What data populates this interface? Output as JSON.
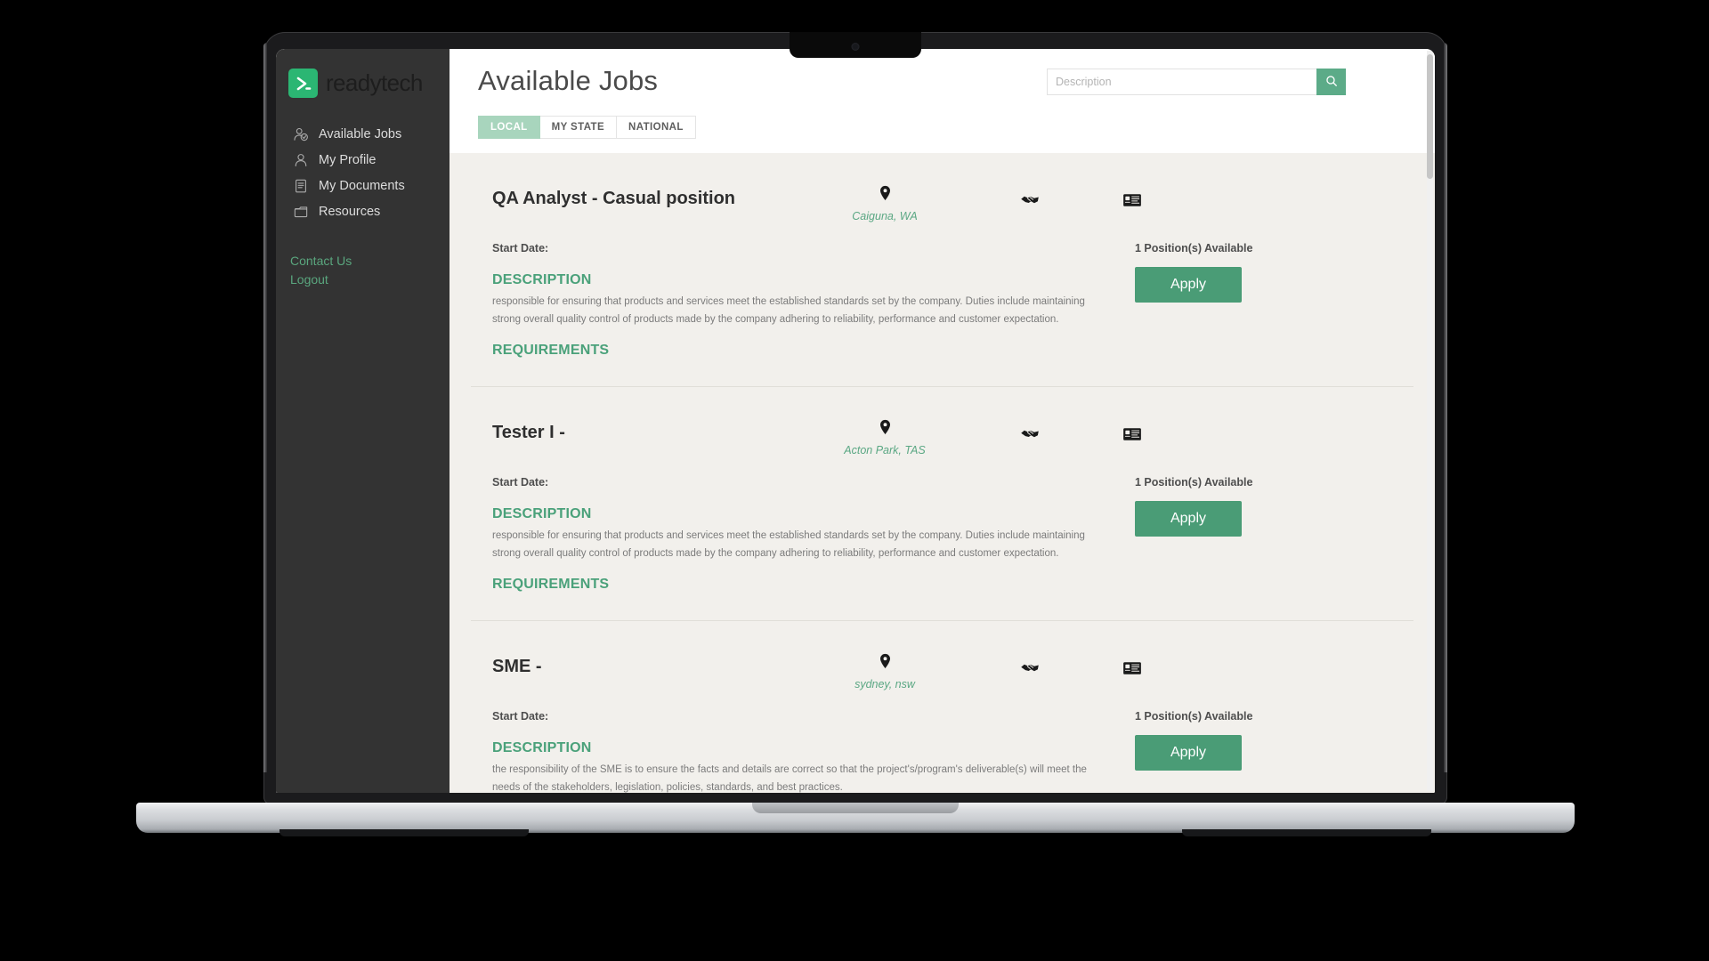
{
  "brand": {
    "name": "readytech",
    "mark_icon": "chevron-right-mark"
  },
  "sidebar": {
    "items": [
      {
        "label": "Available Jobs",
        "icon": "user-check-icon"
      },
      {
        "label": "My Profile",
        "icon": "user-icon"
      },
      {
        "label": "My Documents",
        "icon": "document-icon"
      },
      {
        "label": "Resources",
        "icon": "folder-icon"
      }
    ],
    "links": [
      {
        "label": "Contact Us"
      },
      {
        "label": "Logout"
      }
    ]
  },
  "header": {
    "title": "Available Jobs",
    "search": {
      "placeholder": "Description",
      "value": "",
      "button_icon": "search-icon"
    },
    "tabs": [
      {
        "label": "LOCAL",
        "active": true
      },
      {
        "label": "MY STATE",
        "active": false
      },
      {
        "label": "NATIONAL",
        "active": false
      }
    ]
  },
  "labels": {
    "start_date": "Start Date:",
    "description_heading": "DESCRIPTION",
    "requirements_heading": "REQUIREMENTS",
    "apply_button": "Apply",
    "location_icon": "map-pin-icon",
    "handshake_icon": "handshake-icon",
    "idcard_icon": "id-card-icon"
  },
  "jobs": [
    {
      "title": "QA Analyst - Casual position",
      "location": "Caiguna, WA",
      "start_date": "Start Date:",
      "description": "responsible for ensuring that products and services meet the established standards set by the company. Duties include maintaining strong overall quality control of products made by the company adhering to reliability, performance and customer expectation.",
      "requirements": "",
      "positions": "1 Position(s) Available",
      "apply": "Apply"
    },
    {
      "title": "Tester I -",
      "location": "Acton Park, TAS",
      "start_date": "Start Date:",
      "description": "responsible for ensuring that products and services meet the established standards set by the company. Duties include maintaining strong overall quality control of products made by the company adhering to reliability, performance and customer expectation.",
      "requirements": "",
      "positions": "1 Position(s) Available",
      "apply": "Apply"
    },
    {
      "title": "SME -",
      "location": "sydney, nsw",
      "start_date": "Start Date:",
      "description": "the responsibility of the SME is to ensure the facts and details are correct so that the project's/program's deliverable(s) will meet the needs of the stakeholders, legislation, policies, standards, and best practices.",
      "requirements": "",
      "positions": "1 Position(s) Available",
      "apply": "Apply"
    }
  ],
  "colors": {
    "brand_green": "#2bb673",
    "accent_green": "#4a9c76",
    "tab_active": "#a8d5bd",
    "sidebar_bg": "#333333",
    "page_bg": "#f2f0ec"
  }
}
